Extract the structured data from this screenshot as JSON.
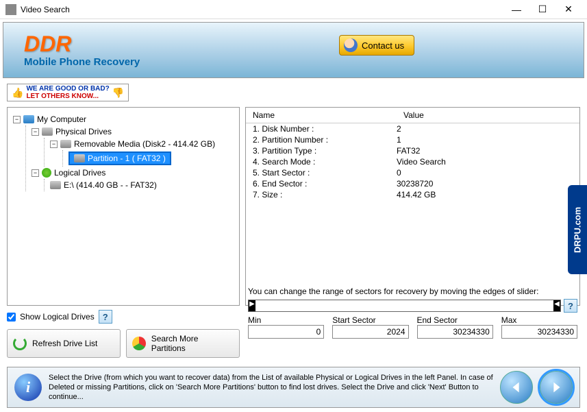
{
  "window": {
    "title": "Video Search"
  },
  "header": {
    "logo_main": "DDR",
    "logo_sub": "Mobile Phone Recovery",
    "contact_label": "Contact us"
  },
  "feedback": {
    "line1": "WE ARE GOOD OR BAD?",
    "line2": "LET OTHERS KNOW..."
  },
  "tree": {
    "root": "My Computer",
    "physical": "Physical Drives",
    "removable": "Removable Media (Disk2 - 414.42 GB)",
    "partition": "Partition - 1 ( FAT32 )",
    "logical": "Logical Drives",
    "elabel": "E:\\ (414.40 GB -  - FAT32)"
  },
  "details": {
    "col_name": "Name",
    "col_value": "Value",
    "rows": [
      {
        "n": "1. Disk Number :",
        "v": "2"
      },
      {
        "n": "2. Partition Number :",
        "v": "1"
      },
      {
        "n": "3. Partition Type :",
        "v": "FAT32"
      },
      {
        "n": "4. Search Mode :",
        "v": "Video Search"
      },
      {
        "n": "5. Start Sector :",
        "v": "0"
      },
      {
        "n": "6. End Sector :",
        "v": "30238720"
      },
      {
        "n": "7. Size :",
        "v": "414.42 GB"
      }
    ]
  },
  "controls": {
    "show_logical": "Show Logical Drives",
    "refresh": "Refresh Drive List",
    "search_more": "Search More Partitions"
  },
  "sectors": {
    "hint": "You can change the range of sectors for recovery by moving the edges of slider:",
    "min_label": "Min",
    "start_label": "Start Sector",
    "end_label": "End Sector",
    "max_label": "Max",
    "min": "0",
    "start": "2024",
    "end": "30234330",
    "max": "30234330"
  },
  "footer": {
    "text": "Select the Drive (from which you want to recover data) from the List of available Physical or Logical Drives in the left Panel. In case of Deleted or missing Partitions, click on 'Search More Partitions' button to find lost drives. Select the Drive and click 'Next' Button to continue..."
  },
  "side": {
    "label": "DRPU.com"
  }
}
